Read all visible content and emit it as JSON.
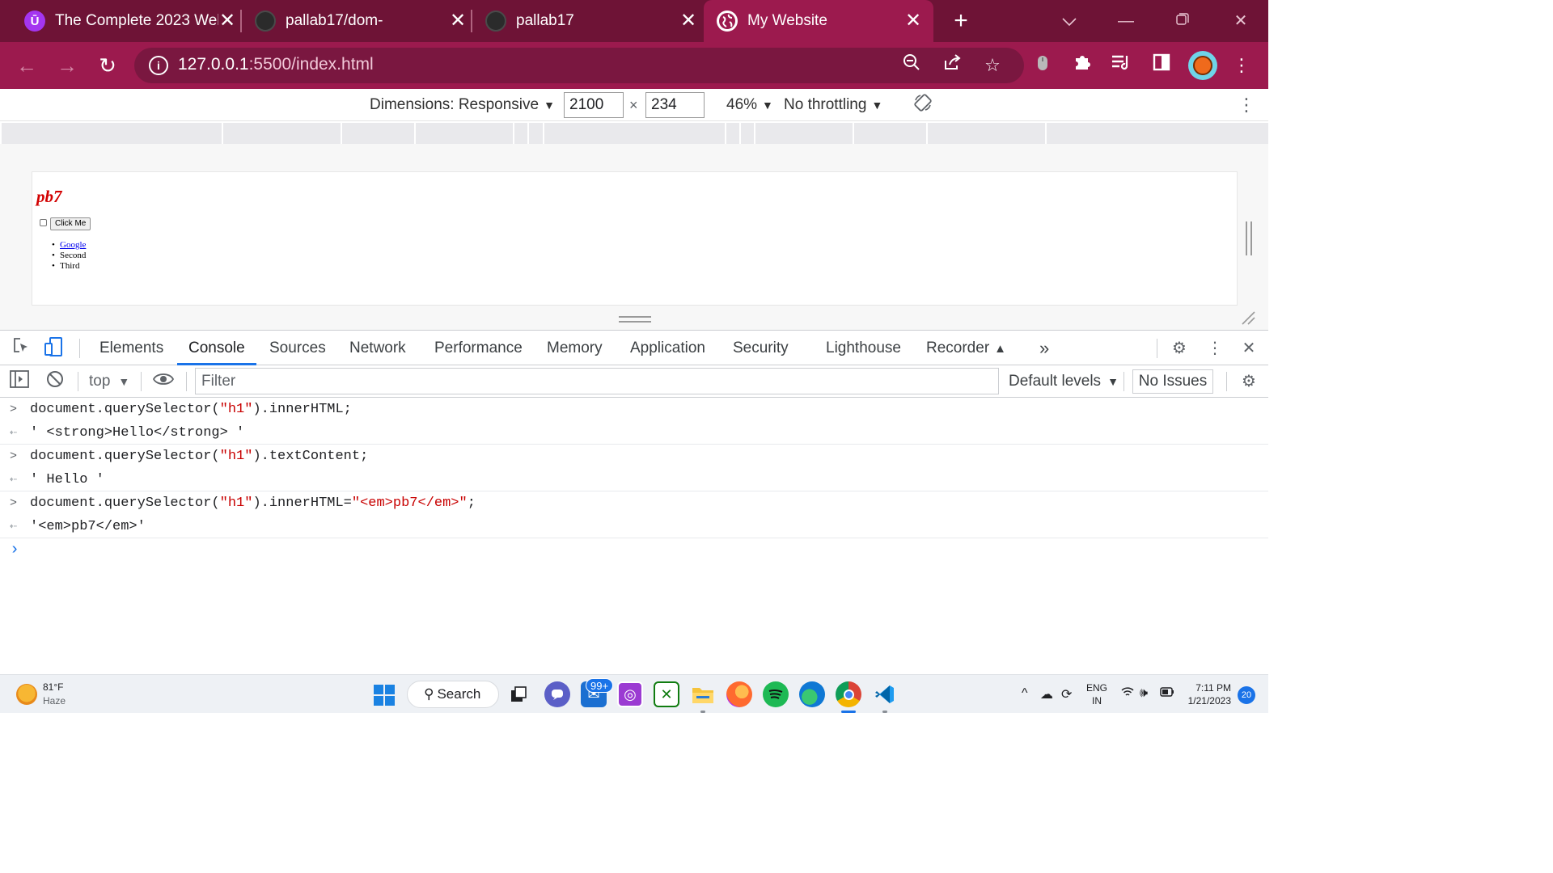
{
  "browser": {
    "tabs": [
      {
        "title": "The Complete 2023 Web",
        "close": "✕"
      },
      {
        "title": "pallab17/dom-",
        "close": "✕"
      },
      {
        "title": "pallab17",
        "close": "✕"
      },
      {
        "title": "My Website",
        "close": "✕"
      }
    ],
    "new_tab": "+",
    "address": {
      "host": "127.0.0.1",
      "rest": ":5500/index.html"
    }
  },
  "device_toolbar": {
    "dimensions_label": "Dimensions: Responsive",
    "width": "2100",
    "times": "×",
    "height": "234",
    "zoom": "46%",
    "throttling": "No throttling"
  },
  "page": {
    "heading": "pb7",
    "button_label": "Click Me",
    "list": [
      {
        "text": "Google",
        "link": true
      },
      {
        "text": "Second",
        "link": false
      },
      {
        "text": "Third",
        "link": false
      }
    ]
  },
  "devtools": {
    "tabs": [
      "Elements",
      "Console",
      "Sources",
      "Network",
      "Performance",
      "Memory",
      "Application",
      "Security",
      "Lighthouse",
      "Recorder"
    ],
    "active_tab": "Console",
    "more": "»",
    "context": "top",
    "filter_placeholder": "Filter",
    "levels": "Default levels",
    "issues": "No Issues"
  },
  "console": {
    "entries": [
      {
        "input_pre": "document.querySelector(",
        "input_str": "\"h1\"",
        "input_post": ").innerHTML;",
        "output": "' <strong>Hello</strong> '"
      },
      {
        "input_pre": "document.querySelector(",
        "input_str": "\"h1\"",
        "input_post": ").textContent;",
        "output": "' Hello '"
      },
      {
        "input_pre": "document.querySelector(",
        "input_str": "\"h1\"",
        "input_mid": ").innerHTML=",
        "input_str2": "\"<em>pb7</em>\"",
        "input_post": ";",
        "output": "'<em>pb7</em>'"
      }
    ],
    "prompt": "›"
  },
  "taskbar": {
    "weather_temp": "81°F",
    "weather_desc": "Haze",
    "search_label": "Search",
    "mail_badge": "99+",
    "lang_top": "ENG",
    "lang_bottom": "IN",
    "time": "7:11 PM",
    "date": "1/21/2023",
    "notifications": "20"
  },
  "colors": {
    "tab_strip": "#6e1336",
    "toolbar": "#9c1a4e",
    "accent": "#1a73e8",
    "string_red": "#c80000"
  }
}
